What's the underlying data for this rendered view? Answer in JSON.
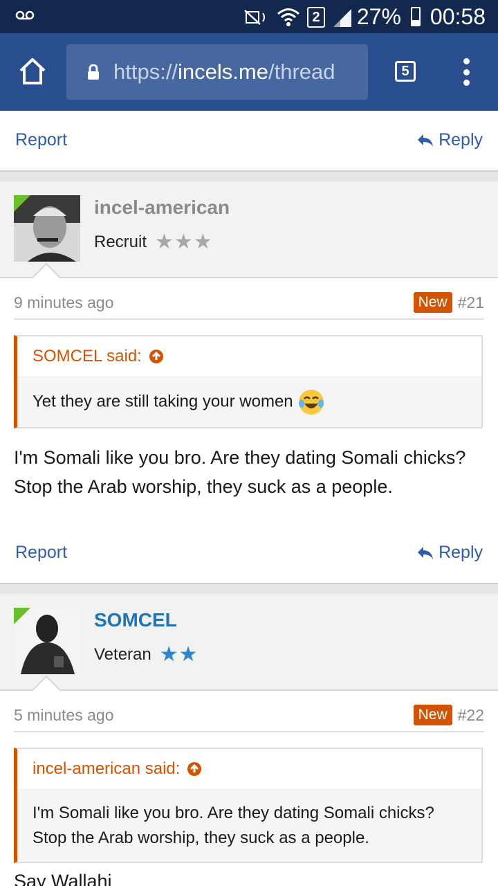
{
  "statusbar": {
    "sim": "2",
    "battery": "27%",
    "time": "00:58"
  },
  "browser": {
    "url_scheme": "https://",
    "url_host": "incels.me",
    "url_path": "/thread",
    "tab_count": "5"
  },
  "prev_post": {
    "report": "Report",
    "reply": "Reply"
  },
  "posts": [
    {
      "username": "incel-american",
      "username_color": "#8a8a8a",
      "title": "Recruit",
      "stars": "★★★",
      "star_color": "#a8a8a8",
      "time": "9 minutes ago",
      "badge": "New",
      "number": "#21",
      "quote_author": "SOMCEL said:",
      "quote_text": "Yet they are still taking your women",
      "message": "I'm Somali like you bro. Are they dating Somali chicks? Stop the Arab worship, they suck as a people.",
      "report": "Report",
      "reply": "Reply"
    },
    {
      "username": "SOMCEL",
      "username_color": "#1f73b7",
      "title": "Veteran",
      "stars": "★★",
      "star_color": "#2f86d0",
      "time": "5 minutes ago",
      "badge": "New",
      "number": "#22",
      "quote_author": "incel-american said:",
      "quote_text": "I'm Somali like you bro. Are they dating Somali chicks? Stop the Arab worship, they suck as a people.",
      "message": "Say Wallahi"
    }
  ]
}
